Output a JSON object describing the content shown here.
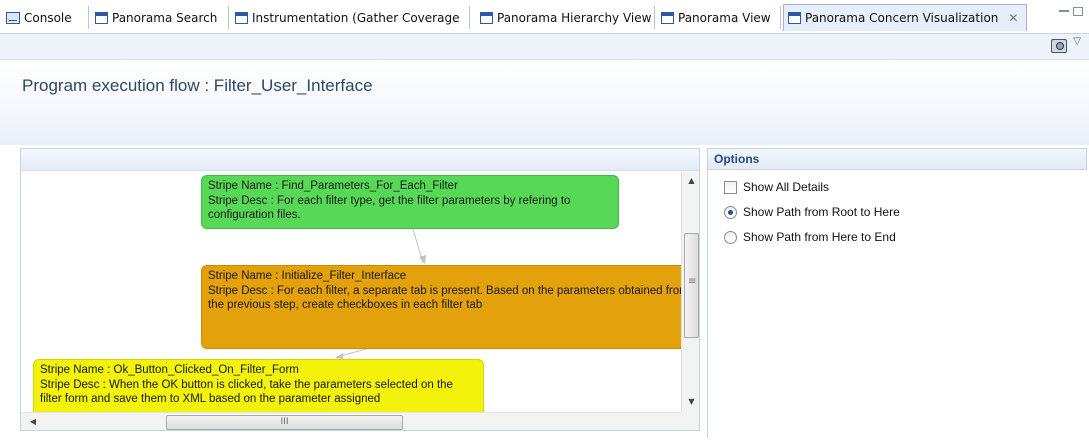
{
  "tabs": [
    {
      "label": "Console",
      "icon": "console-icon"
    },
    {
      "label": "Panorama Search",
      "icon": "view-icon"
    },
    {
      "label": "Instrumentation (Gather Coverage",
      "icon": "view-icon"
    },
    {
      "label": "Panorama Hierarchy View",
      "icon": "view-icon"
    },
    {
      "label": "Panorama View",
      "icon": "view-icon"
    },
    {
      "label": "Panorama Concern Visualization",
      "icon": "view-icon",
      "active": true,
      "close": "✕"
    }
  ],
  "header": {
    "title": "Program execution flow : Filter_User_Interface"
  },
  "flow": {
    "stripes": [
      {
        "name": "Stripe Name : Find_Parameters_For_Each_Filter",
        "desc": "Stripe Desc : For each filter type, get the filter parameters by refering to configuration files.",
        "color": "#57d957"
      },
      {
        "name": "Stripe Name : Initialize_Filter_Interface",
        "desc": "Stripe Desc : For each filter, a separate tab is present. Based on the parameters obtained from the previous step, create checkboxes in each filter tab",
        "color": "#e3a20b"
      },
      {
        "name": "Stripe Name : Ok_Button_Clicked_On_Filter_Form",
        "desc": "Stripe Desc : When the OK button is clicked, take the parameters selected on the filter form and save them to XML based on the parameter assigned",
        "color": "#f2f20a"
      }
    ],
    "scroll_glyphs": {
      "up": "▲",
      "down": "▼",
      "left": "◀",
      "right": "▶",
      "grip": "III"
    }
  },
  "options": {
    "title": "Options",
    "items": [
      {
        "label": "Show All Details",
        "type": "checkbox",
        "checked": false
      },
      {
        "label": "Show Path from Root to Here",
        "type": "radio",
        "checked": true
      },
      {
        "label": "Show Path from Here to End",
        "type": "radio",
        "checked": false
      }
    ]
  },
  "colors": {
    "accent": "#254a87",
    "title_text": "#2f4666"
  }
}
